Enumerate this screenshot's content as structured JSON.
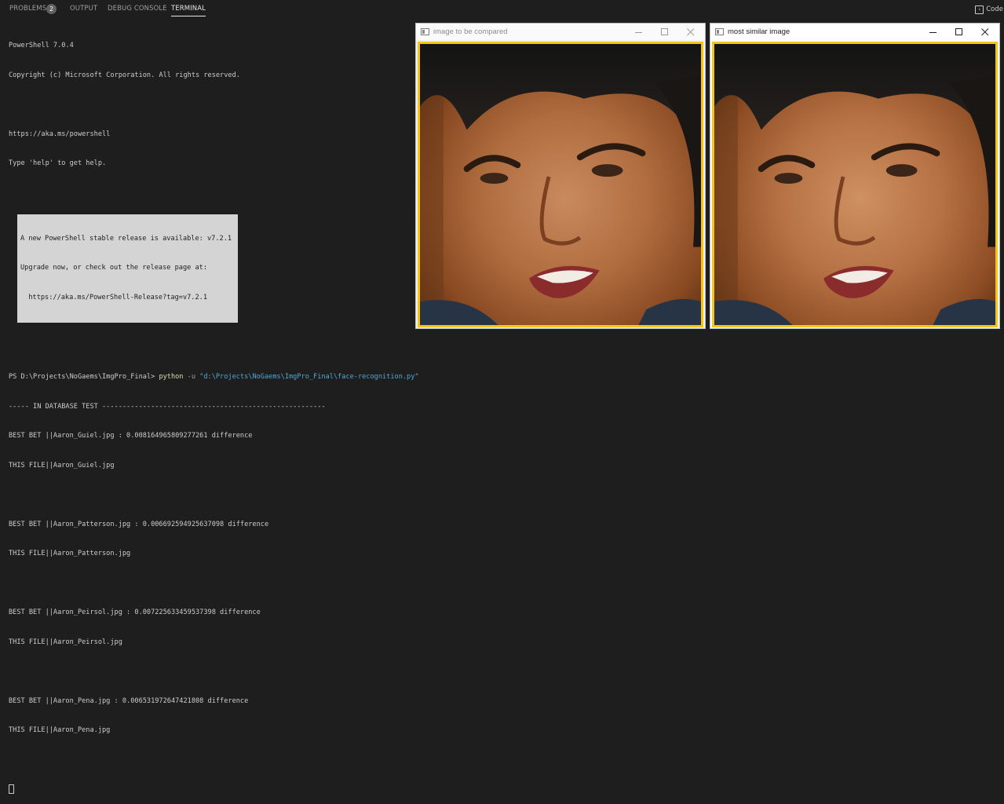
{
  "panel": {
    "tabs": [
      {
        "label": "PROBLEMS",
        "badge": "2"
      },
      {
        "label": "OUTPUT"
      },
      {
        "label": "DEBUG CONSOLE"
      },
      {
        "label": "TERMINAL",
        "active": true
      }
    ],
    "right_button": {
      "label": "Code",
      "icon": "terminal-icon"
    }
  },
  "terminal": {
    "lines_top": [
      "PowerShell 7.0.4",
      "Copyright (c) Microsoft Corporation. All rights reserved.",
      "",
      "https://aka.ms/powershell",
      "Type 'help' to get help."
    ],
    "update_box": [
      "A new PowerShell stable release is available: v7.2.1",
      "Upgrade now, or check out the release page at:",
      "  https://aka.ms/PowerShell-Release?tag=v7.2.1"
    ],
    "prompt": "PS D:\\Projects\\NoGaems\\ImgPro_Final> ",
    "command": "python",
    "flag": " -u ",
    "script_path": "\"d:\\Projects\\NoGaems\\ImgPro_Final\\face-recognition.py\"",
    "output": [
      "----- IN DATABASE TEST -------------------------------------------------------",
      "BEST BET ||Aaron_Guiel.jpg : 0.008164965809277261 difference",
      "THIS FILE||Aaron_Guiel.jpg",
      "",
      "BEST BET ||Aaron_Patterson.jpg : 0.006692594925637098 difference",
      "THIS FILE||Aaron_Patterson.jpg",
      "",
      "BEST BET ||Aaron_Peirsol.jpg : 0.007225633459537398 difference",
      "THIS FILE||Aaron_Peirsol.jpg",
      "",
      "BEST BET ||Aaron_Pena.jpg : 0.006531972647421808 difference",
      "THIS FILE||Aaron_Pena.jpg",
      ""
    ]
  },
  "windows": [
    {
      "title": "image to be compared",
      "frame_color": "#f5c518"
    },
    {
      "title": "most similar image",
      "frame_color": "#f5c518"
    }
  ],
  "colors": {
    "background": "#1e1e1e",
    "text": "#cccccc",
    "accent_yellow": "#f5c518",
    "string": "#4fa8d6",
    "function": "#dcdcaa"
  }
}
